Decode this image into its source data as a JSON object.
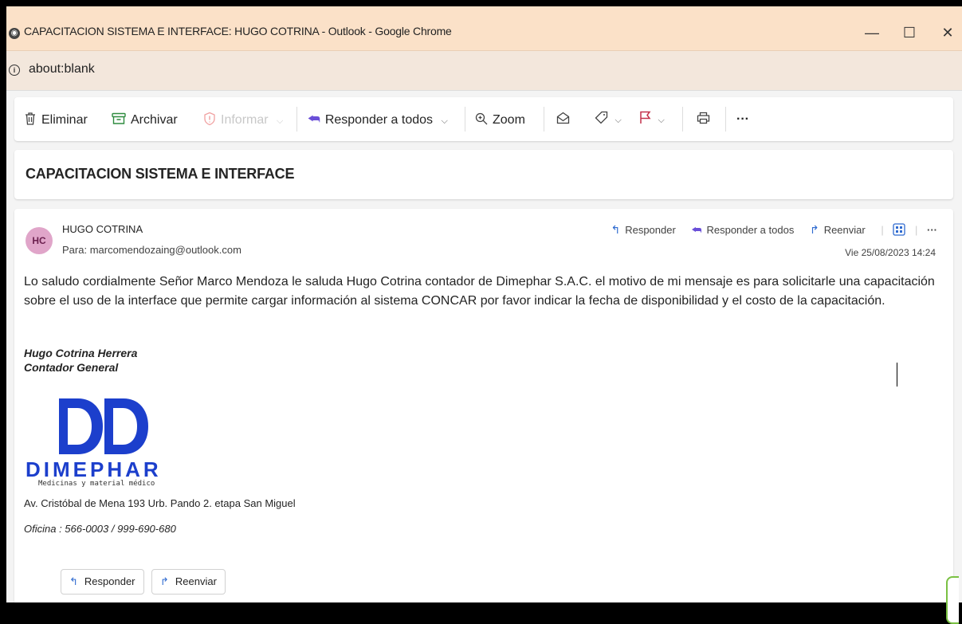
{
  "window": {
    "title": "CAPACITACION SISTEMA E INTERFACE: HUGO COTRINA - Outlook - Google Chrome",
    "minimize": "—",
    "maximize": "☐",
    "close": "✕"
  },
  "address": {
    "url": "about:blank"
  },
  "toolbar": {
    "delete": "Eliminar",
    "archive": "Archivar",
    "report": "Informar",
    "reply_all": "Responder a todos",
    "zoom": "Zoom",
    "more": "···"
  },
  "subject": "CAPACITACION SISTEMA E INTERFACE",
  "message": {
    "avatar_initials": "HC",
    "sender": "HUGO COTRINA",
    "to_label": "Para:",
    "to": "marcomendozaing@outlook.com",
    "date": "Vie 25/08/2023 14:24",
    "actions": {
      "reply": "Responder",
      "reply_all": "Responder a todos",
      "forward": "Reenviar",
      "more": "···"
    },
    "body": "Lo saludo cordialmente Señor Marco Mendoza le saluda Hugo Cotrina contador de Dimephar S.A.C.  el motivo de mi mensaje es para solicitarle una capacitación sobre el uso de la interface que permite cargar información al sistema CONCAR por favor indicar la fecha de disponibilidad y el costo de la capacitación.",
    "signature": {
      "name": "Hugo Cotrina Herrera",
      "role": "Contador General",
      "logo_brand": "DIMEPHAR",
      "logo_tagline": "Medicinas y material médico",
      "address": "Av. Cristóbal de Mena 193 Urb. Pando 2. etapa San Miguel",
      "office": "Oficina : 566-0003 / 999-690-680"
    },
    "footer": {
      "reply": "Responder",
      "forward": "Reenviar"
    }
  },
  "colors": {
    "titlebar": "#fbe1c8",
    "addressbar": "#f3e7dc",
    "accent_blue": "#2f6bd0",
    "flag_red": "#c4314b",
    "brand_blue": "#1c3fcc",
    "avatar": "#e0a5c9"
  }
}
